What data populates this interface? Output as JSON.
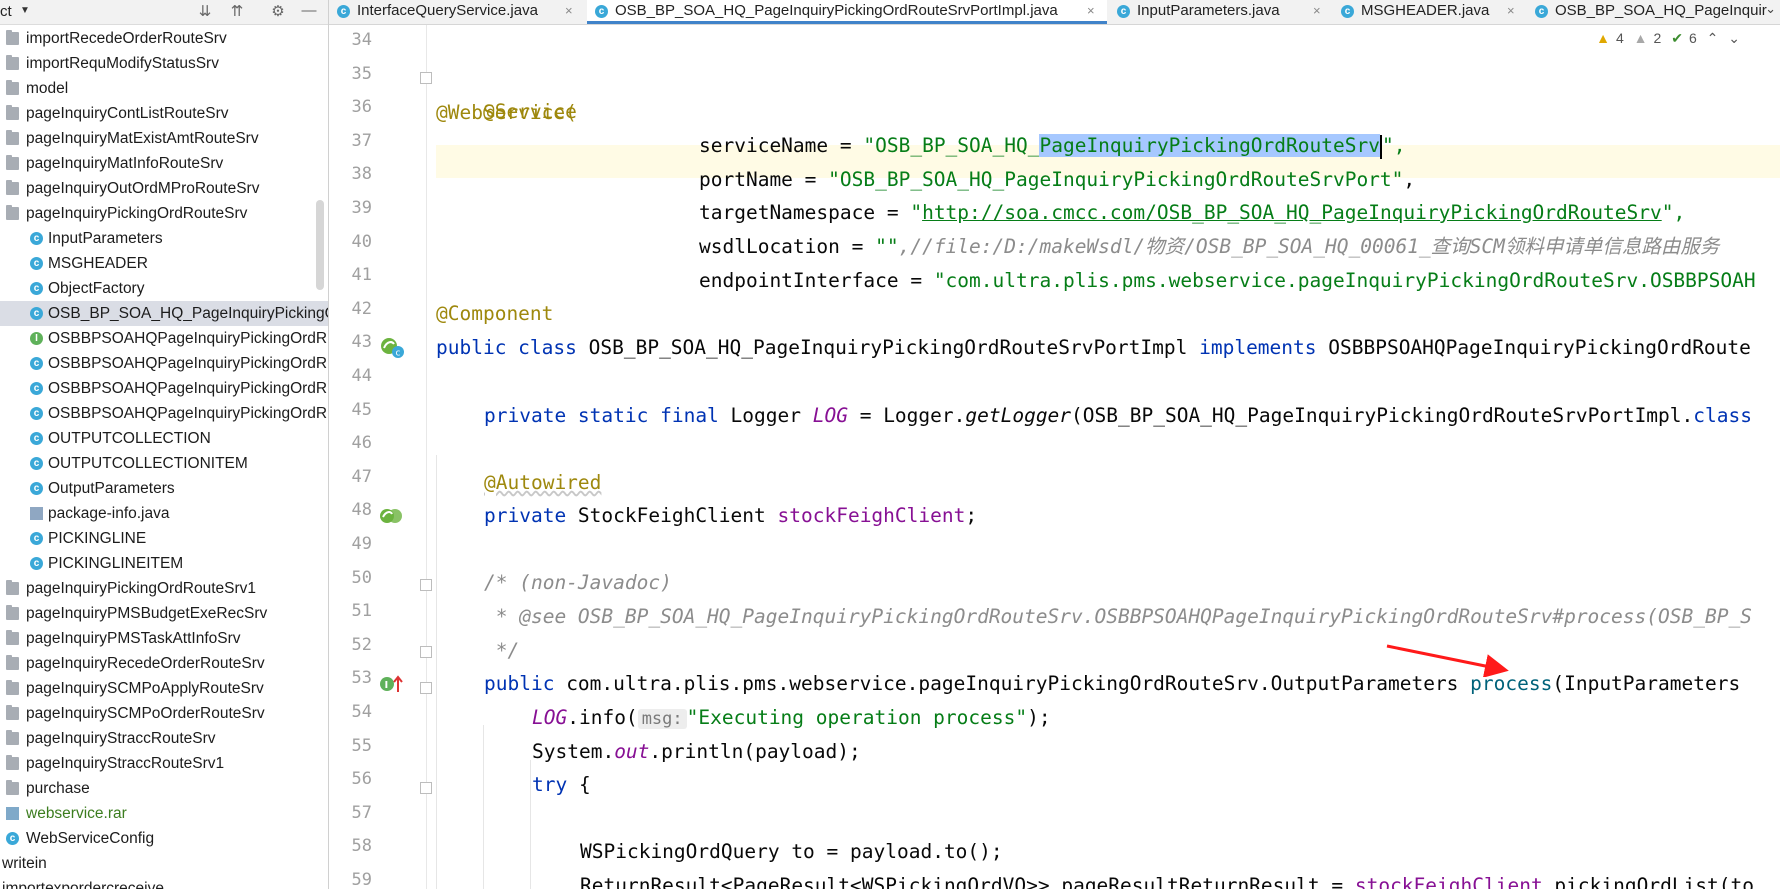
{
  "project_panel": {
    "title": "ct",
    "items": [
      {
        "label": "importRecedeOrderRouteSrv",
        "type": "folder",
        "level": 0
      },
      {
        "label": "importRequModifyStatusSrv",
        "type": "folder",
        "level": 0
      },
      {
        "label": "model",
        "type": "folder",
        "level": 0
      },
      {
        "label": "pageInquiryContListRouteSrv",
        "type": "folder",
        "level": 0
      },
      {
        "label": "pageInquiryMatExistAmtRouteSrv",
        "type": "folder",
        "level": 0
      },
      {
        "label": "pageInquiryMatInfoRouteSrv",
        "type": "folder",
        "level": 0
      },
      {
        "label": "pageInquiryOutOrdMProRouteSrv",
        "type": "folder",
        "level": 0
      },
      {
        "label": "pageInquiryPickingOrdRouteSrv",
        "type": "folder",
        "level": 0
      },
      {
        "label": "InputParameters",
        "type": "class",
        "level": 1
      },
      {
        "label": "MSGHEADER",
        "type": "class",
        "level": 1
      },
      {
        "label": "ObjectFactory",
        "type": "class",
        "level": 1
      },
      {
        "label": "OSB_BP_SOA_HQ_PageInquiryPickingO",
        "type": "class",
        "level": 1,
        "selected": true
      },
      {
        "label": "OSBBPSOAHQPageInquiryPickingOrdR",
        "type": "interface",
        "level": 1
      },
      {
        "label": "OSBBPSOAHQPageInquiryPickingOrdR",
        "type": "class",
        "level": 1
      },
      {
        "label": "OSBBPSOAHQPageInquiryPickingOrdR",
        "type": "class",
        "level": 1
      },
      {
        "label": "OSBBPSOAHQPageInquiryPickingOrdR",
        "type": "class",
        "level": 1
      },
      {
        "label": "OUTPUTCOLLECTION",
        "type": "class",
        "level": 1
      },
      {
        "label": "OUTPUTCOLLECTIONITEM",
        "type": "class",
        "level": 1
      },
      {
        "label": "OutputParameters",
        "type": "class",
        "level": 1
      },
      {
        "label": "package-info.java",
        "type": "file",
        "level": 1
      },
      {
        "label": "PICKINGLINE",
        "type": "class",
        "level": 1
      },
      {
        "label": "PICKINGLINEITEM",
        "type": "class",
        "level": 1
      },
      {
        "label": "pageInquiryPickingOrdRouteSrv1",
        "type": "folder",
        "level": 0
      },
      {
        "label": "pageInquiryPMSBudgetExeRecSrv",
        "type": "folder",
        "level": 0
      },
      {
        "label": "pageInquiryPMSTaskAttInfoSrv",
        "type": "folder",
        "level": 0
      },
      {
        "label": "pageInquiryRecedeOrderRouteSrv",
        "type": "folder",
        "level": 0
      },
      {
        "label": "pageInquirySCMPoApplyRouteSrv",
        "type": "folder",
        "level": 0
      },
      {
        "label": "pageInquirySCMPoOrderRouteSrv",
        "type": "folder",
        "level": 0
      },
      {
        "label": "pageInquiryStraccRouteSrv",
        "type": "folder",
        "level": 0
      },
      {
        "label": "pageInquiryStraccRouteSrv1",
        "type": "folder",
        "level": 0
      },
      {
        "label": "purchase",
        "type": "folder",
        "level": 0
      },
      {
        "label": "webservice.rar",
        "type": "rar",
        "level": 0
      },
      {
        "label": "WebServiceConfig",
        "type": "spring",
        "level": 0
      },
      {
        "label": "writein",
        "type": "plain",
        "level": -1
      },
      {
        "label": "importexpordercreceive",
        "type": "plain",
        "level": -1
      }
    ]
  },
  "tabs": [
    {
      "label": "InterfaceQueryService.java",
      "active": false
    },
    {
      "label": "OSB_BP_SOA_HQ_PageInquiryPickingOrdRouteSrvPortImpl.java",
      "active": true
    },
    {
      "label": "InputParameters.java",
      "active": false
    },
    {
      "label": "MSGHEADER.java",
      "active": false
    },
    {
      "label": "OSB_BP_SOA_HQ_PageInquir",
      "active": false
    }
  ],
  "tab_close_glyph": "×",
  "inspections": {
    "warnings": "4",
    "weak_warnings": "2",
    "ok": "6"
  },
  "line_numbers": [
    "34",
    "35",
    "36",
    "37",
    "38",
    "39",
    "40",
    "41",
    "42",
    "43",
    "44",
    "45",
    "46",
    "47",
    "48",
    "49",
    "50",
    "51",
    "52",
    "53",
    "54",
    "55",
    "56",
    "57",
    "58",
    "59"
  ],
  "code": {
    "l35": "@Service",
    "l36": "@WebService(",
    "l37_a": "serviceName = ",
    "l37_b": "\"OSB_BP_SOA_HQ_",
    "l37_c": "PageInquiryPickingOrdRouteSrv",
    "l37_d": "\",",
    "l38_a": "portName = ",
    "l38_b": "\"OSB_BP_SOA_HQ_PageInquiryPickingOrdRouteSrvPort\"",
    "l38_c": ",",
    "l39_a": "targetNamespace = ",
    "l39_b": "\"",
    "l39_c": "http://soa.cmcc.com/OSB_BP_SOA_HQ_PageInquiryPickingOrdRouteSrv",
    "l39_d": "\",",
    "l40_a": "wsdlLocation = ",
    "l40_b": "\"\"",
    "l40_c": ",//file:/D:/makeWsdl/物资/OSB_BP_SOA_HQ_00061_查询SCM领料申请单信息路由服务",
    "l41_a": "endpointInterface = ",
    "l41_b": "\"com.ultra.plis.pms.webservice.pageInquiryPickingOrdRouteSrv.OSBBPSOAH",
    "l42": "@Component",
    "l43_a": "public class ",
    "l43_b": "OSB_BP_SOA_HQ_PageInquiryPickingOrdRouteSrvPortImpl ",
    "l43_c": "implements ",
    "l43_d": "OSBBPSOAHQPageInquiryPickingOrdRoute",
    "l45_a": "private static final ",
    "l45_b": "Logger ",
    "l45_c": "LOG",
    "l45_d": " = Logger.",
    "l45_e": "getLogger",
    "l45_f": "(OSB_BP_SOA_HQ_PageInquiryPickingOrdRouteSrvPortImpl.",
    "l45_g": "class",
    "l47": "@Autowired",
    "l48_a": "private ",
    "l48_b": "StockFeighClient ",
    "l48_c": "stockFeighClient",
    "l48_d": ";",
    "l50": "/* (non-Javadoc)",
    "l51": " * @see OSB_BP_SOA_HQ_PageInquiryPickingOrdRouteSrv.OSBBPSOAHQPageInquiryPickingOrdRouteSrv#process(OSB_BP_S",
    "l52": " */",
    "l53_a": "public ",
    "l53_b": "com.ultra.plis.pms.webservice.pageInquiryPickingOrdRouteSrv.OutputParameters ",
    "l53_c": "process",
    "l53_d": "(InputParameters",
    "l54_a": "LOG",
    "l54_b": ".info(",
    "l54_hint": "msg:",
    "l54_c": "\"Executing operation process\"",
    "l54_d": ");",
    "l55_a": "System.",
    "l55_b": "out",
    "l55_c": ".println(payload);",
    "l56_a": "try ",
    "l56_b": "{",
    "l58": "WSPickingOrdQuery to = payload.to();",
    "l59_a": "ReturnResult<PageResult<WSPickingOrdVO>> pageResultReturnResult = ",
    "l59_b": "stockFeighClient",
    "l59_c": ".pickingOrdList(to"
  }
}
